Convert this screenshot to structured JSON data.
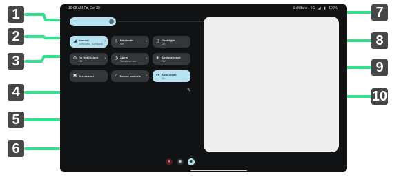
{
  "status_bar": {
    "time_date": "10:08 AM Fri, Oct 20",
    "right": "SoftBank",
    "network": "5G",
    "battery": "100%"
  },
  "brightness": {
    "icon": "brightness-icon"
  },
  "tiles": {
    "internet": {
      "title": "Internet",
      "sub": "SoftBank, SoftBank",
      "icon": "signal-icon"
    },
    "bluetooth": {
      "title": "Bluetooth",
      "sub": "Off",
      "icon": "bluetooth-icon"
    },
    "flashlight": {
      "title": "Flashlight",
      "sub": "Off",
      "icon": "flashlight-icon"
    },
    "dnd": {
      "title": "Do Not Disturb",
      "sub": "Off",
      "icon": "dnd-icon"
    },
    "alarm": {
      "title": "Alarm",
      "sub": "No alarm set",
      "icon": "alarm-icon"
    },
    "airplane": {
      "title": "Airplane mode",
      "sub": "Off",
      "icon": "airplane-icon"
    },
    "screenshot": {
      "title": "Screenshot",
      "sub": "",
      "icon": "screenshot-icon"
    },
    "device_controls": {
      "title": "Device controls",
      "sub": "",
      "icon": "home-icon"
    },
    "auto_rotate": {
      "title": "Auto-rotate",
      "sub": "On",
      "icon": "rotate-icon"
    }
  },
  "callouts": [
    "1",
    "2",
    "3",
    "4",
    "5",
    "6",
    "7",
    "8",
    "9",
    "10"
  ],
  "colors": {
    "accent": "#b8e2ef",
    "callout_line": "#33e08e",
    "callout_box": "#464646",
    "tile_off": "#34363a"
  }
}
